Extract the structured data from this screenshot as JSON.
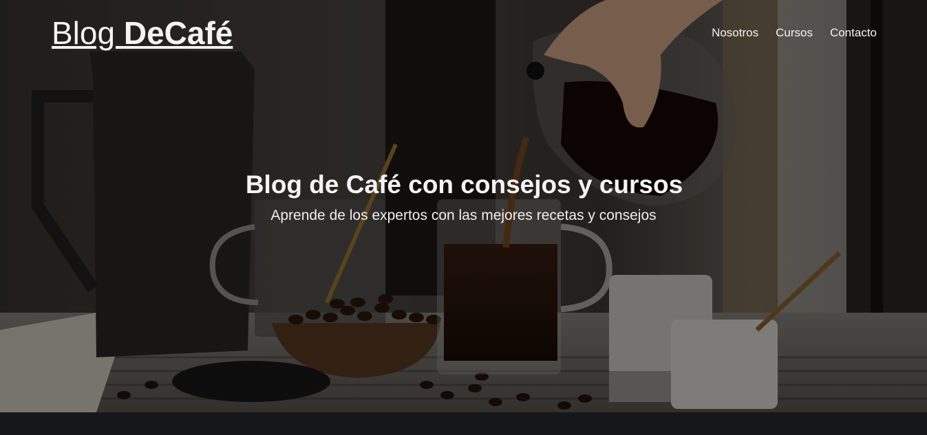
{
  "header": {
    "logo_regular": "Blog ",
    "logo_bold": "DeCafé",
    "nav": [
      {
        "label": "Nosotros"
      },
      {
        "label": "Cursos"
      },
      {
        "label": "Contacto"
      }
    ]
  },
  "hero": {
    "title": "Blog de Café con consejos y cursos",
    "subtitle": "Aprende de los expertos con las mejores recetas y consejos"
  }
}
